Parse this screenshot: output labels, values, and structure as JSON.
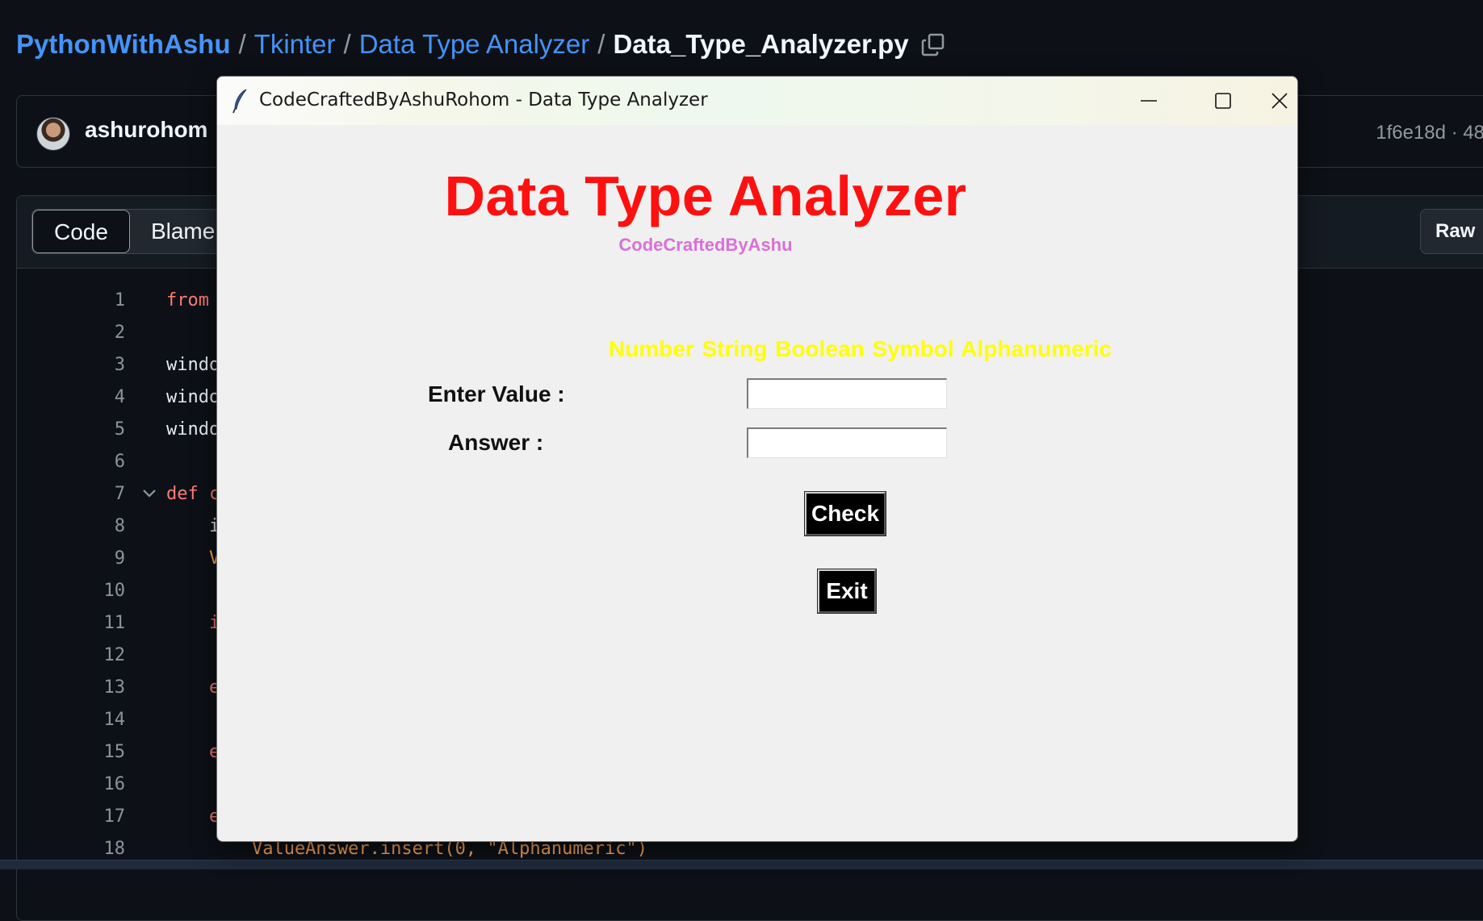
{
  "breadcrumb": {
    "repo": "PythonWithAshu",
    "folder": "Tkinter",
    "subfolder": "Data Type Analyzer",
    "file": "Data_Type_Analyzer.py",
    "separator": "/"
  },
  "commit": {
    "author": "ashurohom",
    "meta": "1f6e18d · 48"
  },
  "file_header": {
    "tabs": [
      "Code",
      "Blame"
    ],
    "active_tab": "Code",
    "raw_label": "Raw"
  },
  "code": {
    "lines": [
      {
        "n": "1",
        "text": "from"
      },
      {
        "n": "2",
        "text": ""
      },
      {
        "n": "3",
        "text": "windo"
      },
      {
        "n": "4",
        "text": "windo"
      },
      {
        "n": "5",
        "text": "windo"
      },
      {
        "n": "6",
        "text": ""
      },
      {
        "n": "7",
        "text": "def c"
      },
      {
        "n": "8",
        "text": "    i"
      },
      {
        "n": "9",
        "text": "    V"
      },
      {
        "n": "10",
        "text": ""
      },
      {
        "n": "11",
        "text": "    i"
      },
      {
        "n": "12",
        "text": ""
      },
      {
        "n": "13",
        "text": "    e"
      },
      {
        "n": "14",
        "text": ""
      },
      {
        "n": "15",
        "text": "    e"
      },
      {
        "n": "16",
        "text": ""
      },
      {
        "n": "17",
        "text": "    e"
      },
      {
        "n": "18",
        "text": "        ValueAnswer.insert(0, \"Alphanumeric\")"
      }
    ]
  },
  "tk_window": {
    "title": "CodeCraftedByAshuRohom - Data Type Analyzer",
    "heading": "Data Type Analyzer",
    "subheading": "CodeCraftedByAshu",
    "types_hint": "Number String Boolean Symbol Alphanumeric",
    "enter_label": "Enter Value :",
    "answer_label": "Answer :",
    "enter_value": "",
    "answer_value": "",
    "check_button": "Check",
    "exit_button": "Exit"
  },
  "colors": {
    "heading": "#ff1010",
    "subheading": "#da70d6",
    "types_hint": "#ffff00",
    "link": "#4493f8",
    "button_bg": "#000000"
  },
  "icons": [
    "copy-icon",
    "feather-icon",
    "minimize-icon",
    "maximize-icon",
    "close-icon",
    "chevron-down-icon"
  ]
}
